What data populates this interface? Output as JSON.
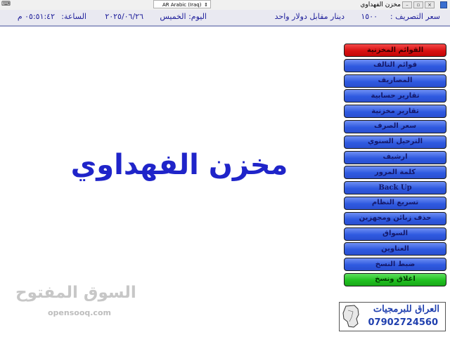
{
  "window": {
    "title": "مخزن الفهداوي",
    "language_selector": "AR Arabic (Iraq)"
  },
  "infobar": {
    "exchange_label": "سعر التصريف :",
    "exchange_value": "١٥٠٠",
    "exchange_unit": "دينار مقابل دولار واحد",
    "day_label": "اليوم: الخميس",
    "date_value": "٢٠٢٥/٠٦/٢٦",
    "time_label": "الساعة:",
    "time_value": "٠٥:٥١:٤٢ م"
  },
  "main": {
    "title": "مخزن الفهداوي"
  },
  "menu": {
    "items": [
      {
        "label": "القوائم المخزنية",
        "style": "red"
      },
      {
        "label": "قوائم التالف",
        "style": "blue"
      },
      {
        "label": "المصاريف",
        "style": "blue"
      },
      {
        "label": "تقارير حسابية",
        "style": "blue"
      },
      {
        "label": "تقارير مخزنية",
        "style": "blue"
      },
      {
        "label": "سعر الصرف",
        "style": "blue"
      },
      {
        "label": "الترحيل السنوي",
        "style": "blue"
      },
      {
        "label": "ارشيف",
        "style": "blue"
      },
      {
        "label": "كلمة المرور",
        "style": "blue"
      },
      {
        "label": "Back Up",
        "style": "blue"
      },
      {
        "label": "تسريع النظام",
        "style": "blue"
      },
      {
        "label": "حذف زبائن ومجهزين",
        "style": "blue"
      },
      {
        "label": "السواق",
        "style": "blue"
      },
      {
        "label": "العناوين",
        "style": "blue"
      },
      {
        "label": "ضبط النسخ",
        "style": "blue"
      },
      {
        "label": "اغلاق ونسخ",
        "style": "green"
      }
    ]
  },
  "ad": {
    "title": "العراق للبرمجيات",
    "phone": "07902724560"
  },
  "watermark": {
    "arabic": "السوق المفتوح",
    "latin": "opensooq.com"
  },
  "colors": {
    "accent_blue": "#1f24c9",
    "menu_blue": "#2f5ae0",
    "menu_red": "#d81010",
    "menu_green": "#20c020"
  }
}
